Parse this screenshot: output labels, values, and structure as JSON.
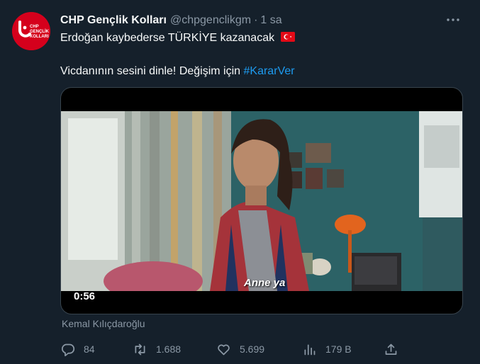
{
  "tweet": {
    "display_name": "CHP Gençlik Kolları",
    "handle": "@chpgenclikgm",
    "separator": "·",
    "time": "1 sa",
    "line1": "Erdoğan kaybederse TÜRKİYE kazanacak",
    "line2_text": "Vicdanının sesini dinle! Değişim için ",
    "hashtag": "#KararVer",
    "flag_icon": "turkey-flag-emoji",
    "avatar_text": [
      "CHP",
      "GENÇLİK",
      "KOLLARI"
    ]
  },
  "media": {
    "duration": "0:56",
    "subtitle": "Anne ya"
  },
  "credit": "Kemal Kılıçdaroğlu",
  "actions": {
    "replies": "84",
    "retweets": "1.688",
    "likes": "5.699",
    "views": "179 B"
  },
  "colors": {
    "background": "#15202b",
    "text": "#f7f9f9",
    "muted": "#8b98a5",
    "link": "#1d9bf0",
    "brand": "#d5001c"
  }
}
